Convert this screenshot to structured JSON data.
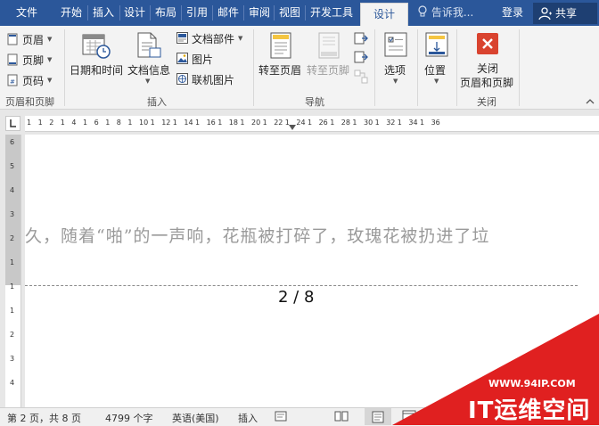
{
  "tabs": [
    "文件",
    "开始",
    "插入",
    "设计",
    "布局",
    "引用",
    "邮件",
    "审阅",
    "视图",
    "开发工具",
    "设计"
  ],
  "active_tab_index": 10,
  "tell_me": "告诉我...",
  "login": "登录",
  "share": "共享",
  "ribbon": {
    "header_footer": {
      "header": "页眉",
      "footer": "页脚",
      "page_number": "页码",
      "group": "页眉和页脚"
    },
    "insert": {
      "date_time": "日期和时间",
      "doc_info": "文档信息",
      "doc_parts": "文档部件",
      "picture": "图片",
      "online_picture": "联机图片",
      "group": "插入"
    },
    "navigation": {
      "goto_header": "转至页眉",
      "goto_footer": "转至页脚",
      "group": "导航"
    },
    "options": {
      "label": "选项"
    },
    "position": {
      "label": "位置"
    },
    "close": {
      "line1": "关闭",
      "line2": "页眉和页脚",
      "group": "关闭"
    }
  },
  "ruler": {
    "h_numbers": [
      "1",
      "1",
      "2",
      "1",
      "4",
      "1",
      "6",
      "1",
      "8",
      "1",
      "10",
      "1",
      "12",
      "1",
      "14",
      "1",
      "16",
      "1",
      "18",
      "1",
      "20",
      "1",
      "22",
      "1",
      "24",
      "1",
      "26",
      "1",
      "28",
      "1",
      "30",
      "1",
      "32",
      "1",
      "34",
      "1",
      "36"
    ],
    "v_numbers": [
      "6",
      "5",
      "4",
      "3",
      "2",
      "1",
      "1",
      "1",
      "2",
      "3",
      "4"
    ]
  },
  "document": {
    "body_text": "久，随着“啪”的一声响，花瓶被打碎了，玫瑰花被扔进了垃",
    "page_number": "2 / 8"
  },
  "status": {
    "page": "第 2 页，共 8 页",
    "words": "4799 个字",
    "language": "英语(美国)",
    "mode": "插入"
  },
  "watermark": {
    "url": "WWW.94IP.COM",
    "brand": "IT运维空间"
  },
  "colors": {
    "tab_bar": "#2b579a",
    "ribbon": "#f3f3f3",
    "close_red": "#d9432f"
  }
}
